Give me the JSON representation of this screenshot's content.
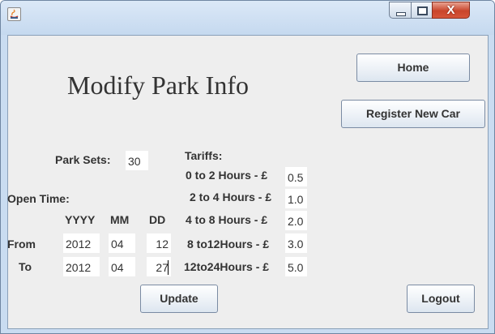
{
  "window": {
    "close_glyph": "X"
  },
  "page": {
    "title": "Modify Park Info"
  },
  "buttons": {
    "home": "Home",
    "register": "Register New Car",
    "update": "Update",
    "logout": "Logout"
  },
  "park": {
    "label": "Park Sets:",
    "value": "30"
  },
  "open_time": {
    "label": "Open Time:",
    "headers": [
      "YYYY",
      "MM",
      "DD"
    ],
    "from": {
      "label": "From",
      "year": "2012",
      "month": "04",
      "day": "12"
    },
    "to": {
      "label": "To",
      "year": "2012",
      "month": "04",
      "day": "27"
    }
  },
  "tariffs": {
    "label": "Tariffs:",
    "rows": [
      {
        "label": "0 to 2 Hours - £",
        "value": "0.5"
      },
      {
        "label": "2 to 4 Hours - £",
        "value": "1.0"
      },
      {
        "label": "4 to 8 Hours - £",
        "value": "2.0"
      },
      {
        "label": "8 to12Hours - £",
        "value": "3.0"
      },
      {
        "label": "12to24Hours - £",
        "value": "5.0"
      }
    ]
  }
}
